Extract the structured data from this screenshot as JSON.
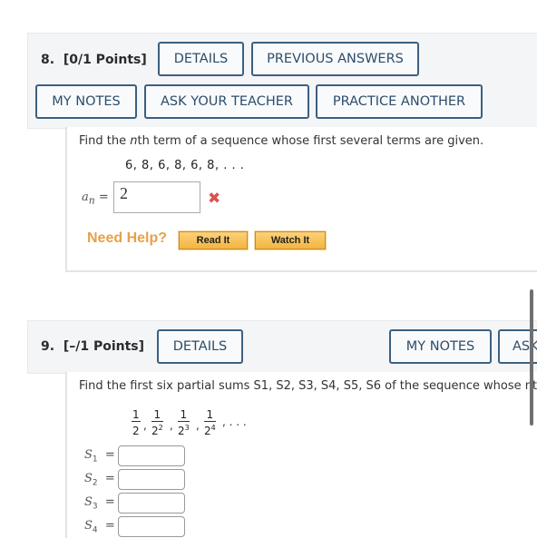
{
  "q8": {
    "number": "8.",
    "points": "[0/1 Points]",
    "buttons": {
      "details": "DETAILS",
      "previous_answers": "PREVIOUS ANSWERS",
      "my_notes": "MY NOTES",
      "ask_teacher": "ASK YOUR TEACHER",
      "practice_another": "PRACTICE ANOTHER"
    },
    "prompt_before": "Find the ",
    "prompt_italic": "n",
    "prompt_after": "th term of a sequence whose first several terms are given.",
    "sequence": "6, 8, 6, 8, 6, 8, . . .",
    "answer_label": "a",
    "answer_label_sub": "n",
    "answer_eq": "=",
    "answer_value": "2",
    "answer_status": "incorrect",
    "answer_status_icon": "✖",
    "need_help": "Need Help?",
    "read_it": "Read It",
    "watch_it": "Watch It"
  },
  "q9": {
    "number": "9.",
    "points": "[–/1 Points]",
    "buttons": {
      "details": "DETAILS",
      "my_notes": "MY NOTES",
      "ask_partial": "ASK"
    },
    "prompt": "Find the first six partial sums S1, S2, S3, S4, S5, S6 of the sequence whose nth",
    "sequence_terms": [
      {
        "num": "1",
        "den": "2",
        "exp": ""
      },
      {
        "num": "1",
        "den": "2",
        "exp": "2"
      },
      {
        "num": "1",
        "den": "2",
        "exp": "3"
      },
      {
        "num": "1",
        "den": "2",
        "exp": "4"
      }
    ],
    "sequence_ellipsis": ". . .",
    "sums": [
      {
        "label": "S",
        "sub": "1",
        "eq": "=",
        "value": ""
      },
      {
        "label": "S",
        "sub": "2",
        "eq": "=",
        "value": ""
      },
      {
        "label": "S",
        "sub": "3",
        "eq": "=",
        "value": ""
      },
      {
        "label": "S",
        "sub": "4",
        "eq": "=",
        "value": ""
      }
    ]
  }
}
